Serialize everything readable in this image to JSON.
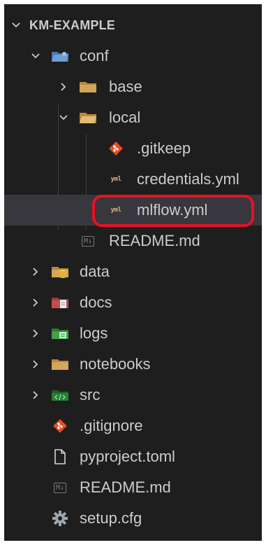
{
  "explorer": {
    "project_name": "KM-EXAMPLE",
    "items": [
      {
        "label": "conf",
        "type": "folder",
        "expanded": true,
        "color": "#6e9ed6"
      },
      {
        "label": "base",
        "type": "folder",
        "expanded": false,
        "color": "#d4a65a"
      },
      {
        "label": "local",
        "type": "folder",
        "expanded": true,
        "color": "#d4a65a"
      },
      {
        "label": ".gitkeep",
        "type": "git-file",
        "color": "#e44d26"
      },
      {
        "label": "credentials.yml",
        "type": "yml-file",
        "icon_text": "yml"
      },
      {
        "label": "mlflow.yml",
        "type": "yml-file",
        "icon_text": "yml",
        "selected": true,
        "circled": true
      },
      {
        "label": "README.md",
        "type": "md-file",
        "icon_text": "M↓"
      },
      {
        "label": "data",
        "type": "folder",
        "expanded": false,
        "color": "#e0b23a"
      },
      {
        "label": "docs",
        "type": "folder",
        "expanded": false,
        "color": "#c0504d"
      },
      {
        "label": "logs",
        "type": "folder",
        "expanded": false,
        "color": "#43a047"
      },
      {
        "label": "notebooks",
        "type": "folder",
        "expanded": false,
        "color": "#d4a65a"
      },
      {
        "label": "src",
        "type": "folder",
        "expanded": false,
        "color": "#2e7d32"
      },
      {
        "label": ".gitignore",
        "type": "git-file",
        "color": "#e44d26"
      },
      {
        "label": "pyproject.toml",
        "type": "text-file"
      },
      {
        "label": "README.md",
        "type": "md-file",
        "icon_text": "M↓"
      },
      {
        "label": "setup.cfg",
        "type": "gear-file",
        "color": "#9aa7b0"
      }
    ]
  },
  "colors": {
    "background": "#1e1e1e",
    "text": "#cccccc",
    "selection": "#37373d",
    "annotation": "#e81123"
  }
}
